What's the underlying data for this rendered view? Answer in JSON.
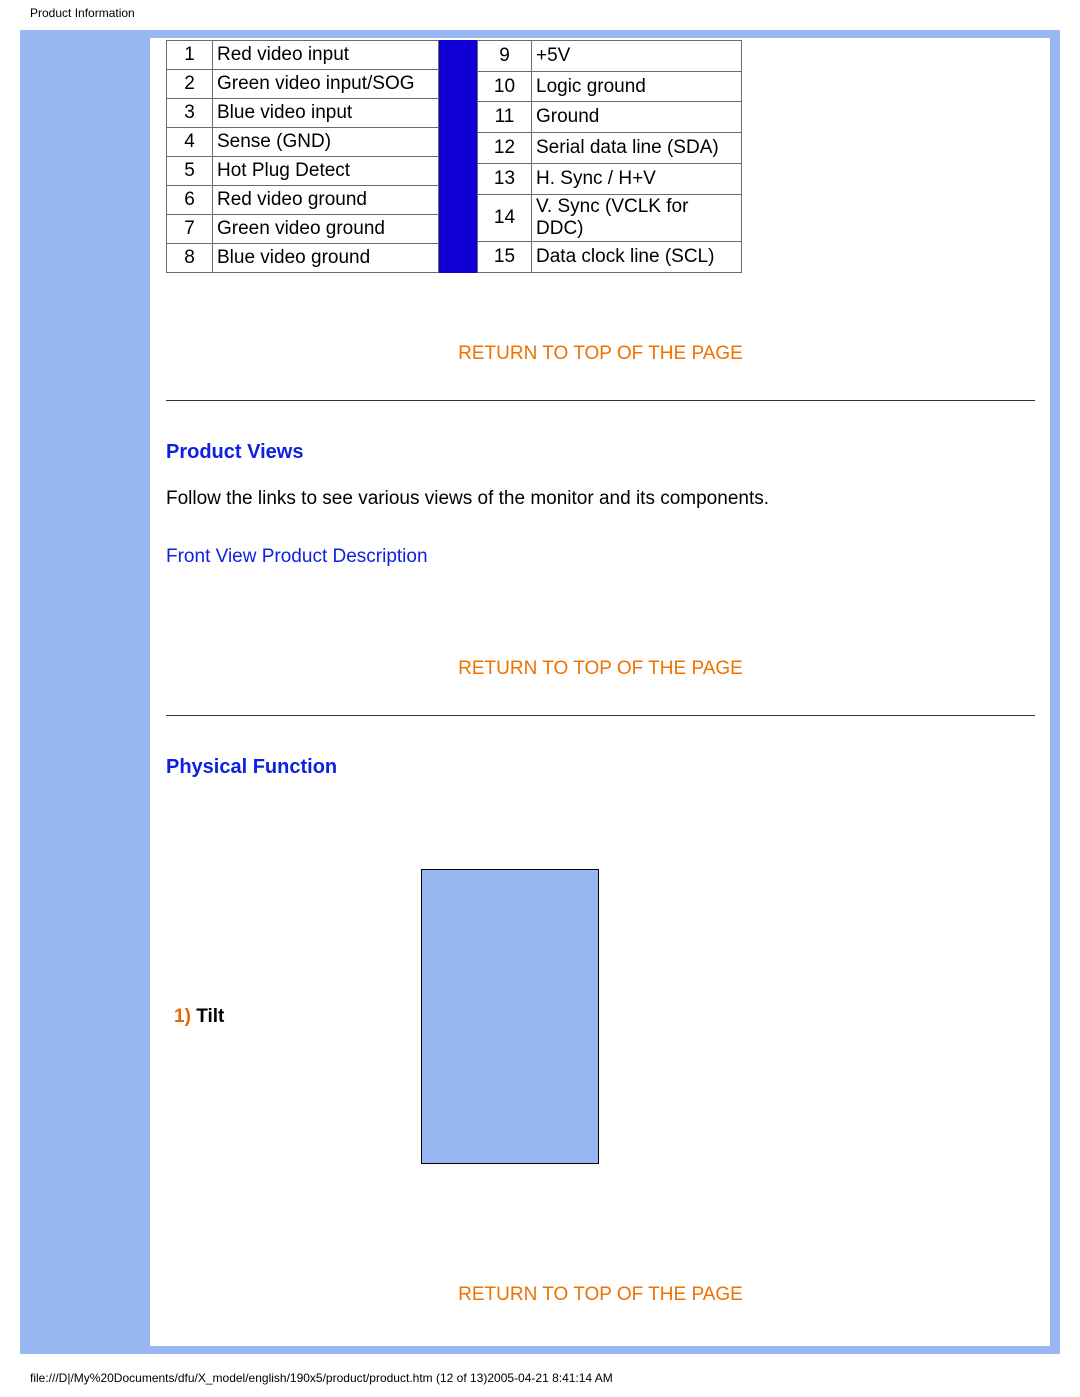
{
  "header_title": "Product Information",
  "pin_table_left": [
    {
      "n": "1",
      "label": "Red video input"
    },
    {
      "n": "2",
      "label": "Green video input/SOG"
    },
    {
      "n": "3",
      "label": "Blue video input"
    },
    {
      "n": "4",
      "label": "Sense (GND)"
    },
    {
      "n": "5",
      "label": "Hot Plug Detect"
    },
    {
      "n": "6",
      "label": "Red video ground"
    },
    {
      "n": "7",
      "label": "Green video ground"
    },
    {
      "n": "8",
      "label": "Blue video ground"
    }
  ],
  "pin_table_right": [
    {
      "n": "9",
      "label": "+5V"
    },
    {
      "n": "10",
      "label": "Logic ground"
    },
    {
      "n": "11",
      "label": "Ground"
    },
    {
      "n": "12",
      "label": "Serial data line (SDA)"
    },
    {
      "n": "13",
      "label": "H. Sync / H+V"
    },
    {
      "n": "14",
      "label": "V. Sync (VCLK for DDC)"
    },
    {
      "n": "15",
      "label": "Data clock line (SCL)"
    }
  ],
  "return_link": "RETURN TO TOP OF THE PAGE",
  "sections": {
    "product_views": {
      "heading": "Product Views",
      "body": "Follow the links to see various views of the monitor and its components.",
      "link": "Front View Product Description"
    },
    "physical_function": {
      "heading": "Physical Function",
      "item1_num": "1)",
      "item1_label": "Tilt"
    }
  },
  "footer": "file:///D|/My%20Documents/dfu/X_model/english/190x5/product/product.htm (12 of 13)2005-04-21 8:41:14 AM"
}
